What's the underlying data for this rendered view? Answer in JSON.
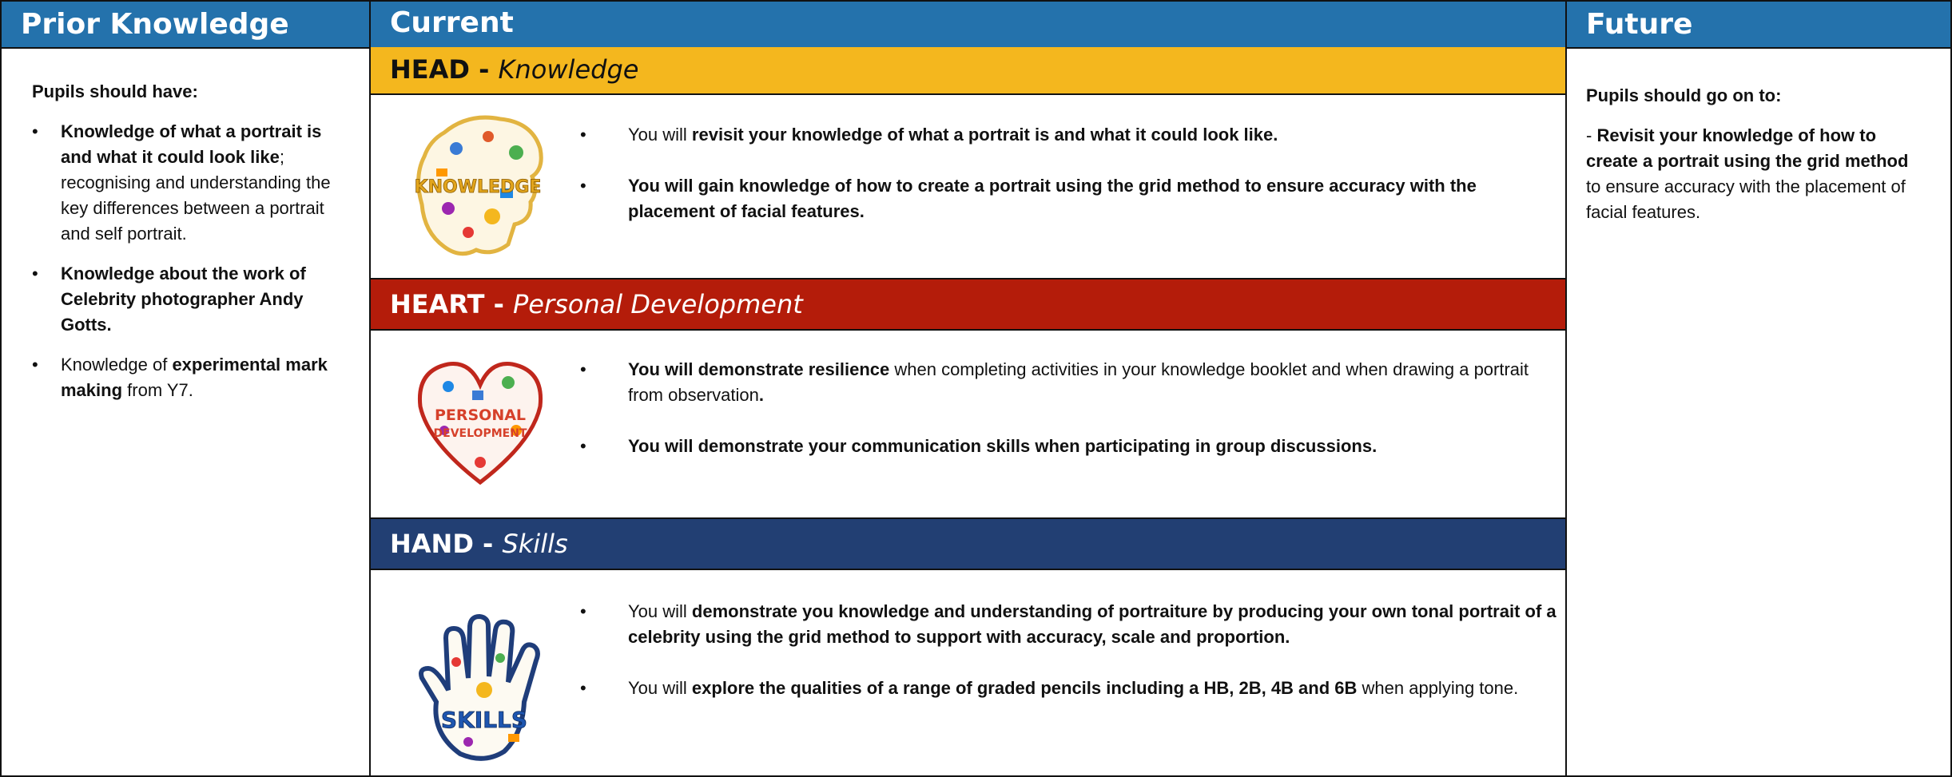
{
  "prior": {
    "header": "Prior Knowledge",
    "intro": "Pupils should have:",
    "items": [
      {
        "b1": "Knowledge of what a portrait is and what it could look like",
        "t1": "; recognising and understanding the key differences between a portrait and self portrait."
      },
      {
        "b1": "Knowledge about the work of Celebrity photographer Andy Gotts."
      },
      {
        "t0": "Knowledge of ",
        "b1": "experimental mark making",
        "t1": " from Y7."
      }
    ]
  },
  "current": {
    "header": "Current",
    "head": {
      "title": "HEAD - ",
      "subtitle": "Knowledge",
      "color": "#f4b71e",
      "emblem_text": "KNOWLEDGE",
      "items": [
        {
          "t0": "You will ",
          "b1": "revisit your knowledge of what a portrait is and what it could look like."
        },
        {
          "b1": "You will gain knowledge of how to create a portrait using the grid method to ensure accuracy with the placement of facial features."
        }
      ]
    },
    "heart": {
      "title": "HEART - ",
      "subtitle": "Personal Development",
      "color": "#b41c0a",
      "emblem_text_1": "PERSONAL",
      "emblem_text_2": "DEVELOPMENT",
      "items": [
        {
          "b1": "You will demonstrate resilience",
          "t1": " when completing activities in your knowledge booklet and when drawing a portrait from observation",
          "b2": "."
        },
        {
          "b1": "You will demonstrate your communication skills when participating in group discussions."
        }
      ]
    },
    "hand": {
      "title": "HAND - ",
      "subtitle": "Skills",
      "color": "#223f73",
      "emblem_text": "SKILLS",
      "items": [
        {
          "t0": "You will ",
          "b1": "demonstrate you knowledge and understanding of portraiture by producing your own tonal portrait of a celebrity using the grid method to support with accuracy, scale and proportion."
        },
        {
          "t0": "You will ",
          "b1": "explore the qualities of a range of graded pencils including a HB, 2B, 4B and 6B",
          "t1": " when applying tone."
        }
      ]
    }
  },
  "future": {
    "header": "Future",
    "intro": "Pupils should go on to:",
    "text_prefix": "- ",
    "bold": "Revisit your knowledge of how to create a portrait using the grid method",
    "rest": " to ensure accuracy with the placement of facial features."
  },
  "colors": {
    "header_blue": "#2472ac",
    "head_yellow": "#f4b71e",
    "heart_red": "#b41c0a",
    "hand_navy": "#223f73"
  }
}
